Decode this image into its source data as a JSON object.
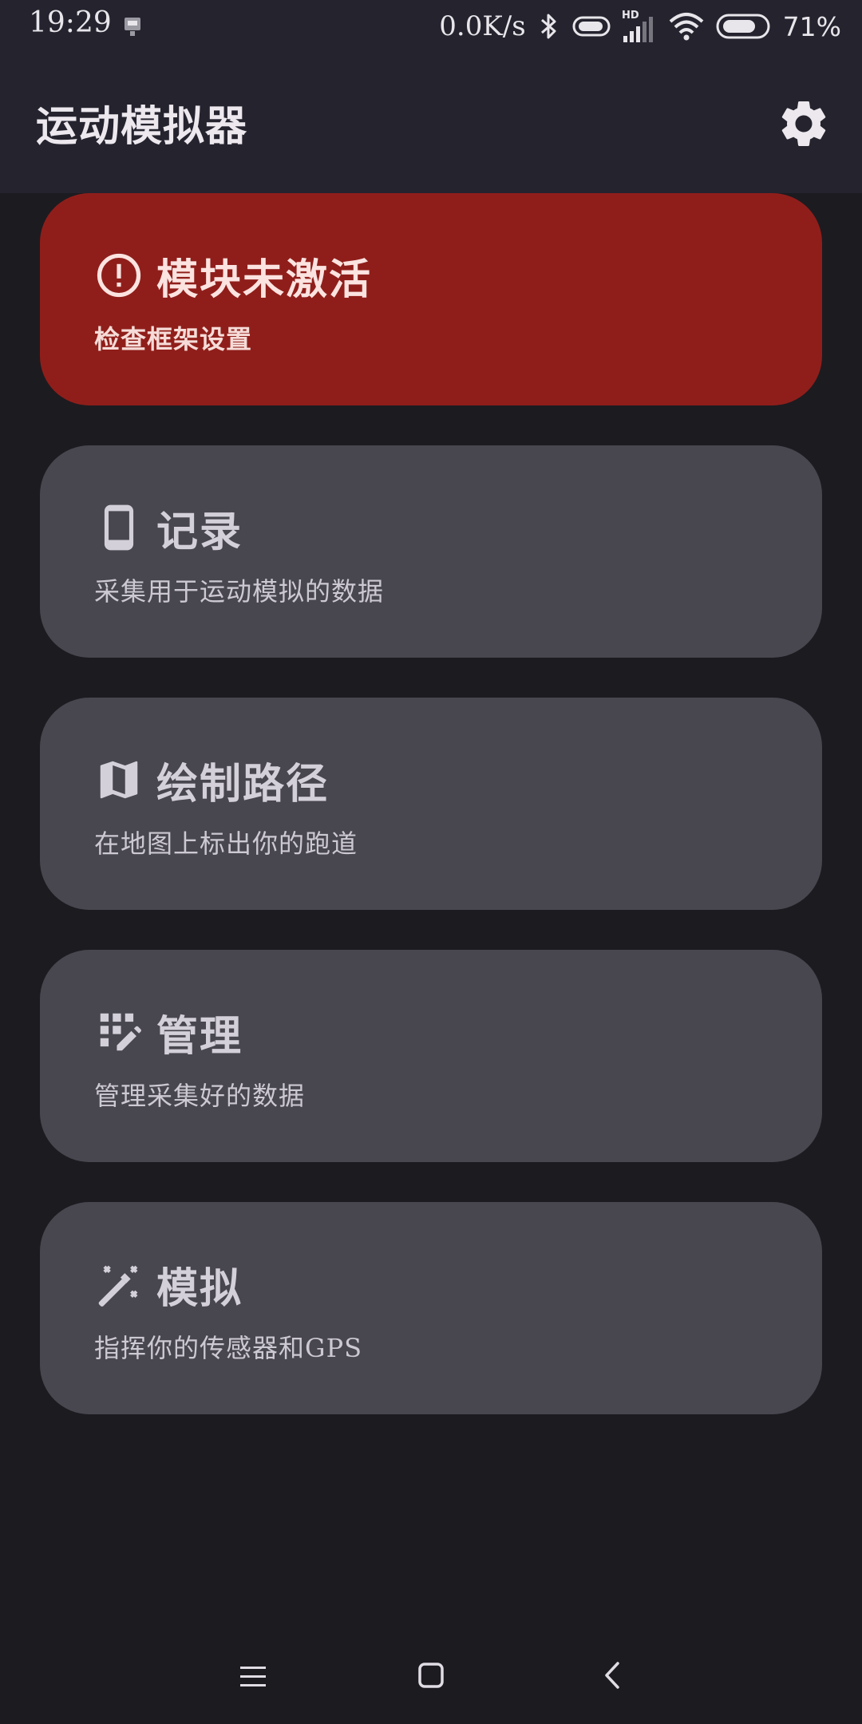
{
  "status_bar": {
    "time": "19:29",
    "net_speed": "0.0K/s",
    "network_label": "HD",
    "battery_percent": "71%"
  },
  "app_bar": {
    "title": "运动模拟器",
    "settings_icon": "gear-icon"
  },
  "cards": [
    {
      "title": "模块未激活",
      "subtitle": "检查框架设置",
      "icon": "alert-circle-icon",
      "accent": "#8f1e1a"
    },
    {
      "title": "记录",
      "subtitle": "采集用于运动模拟的数据",
      "icon": "phone-icon"
    },
    {
      "title": "绘制路径",
      "subtitle": "在地图上标出你的跑道",
      "icon": "map-icon"
    },
    {
      "title": "管理",
      "subtitle": "管理采集好的数据",
      "icon": "grid-edit-icon"
    },
    {
      "title": "模拟",
      "subtitle": "指挥你的传感器和GPS",
      "icon": "magic-wand-icon"
    }
  ],
  "colors": {
    "background": "#1c1b20",
    "app_bar": "#25232e",
    "card": "#48464f",
    "alert": "#8f1e1a"
  }
}
